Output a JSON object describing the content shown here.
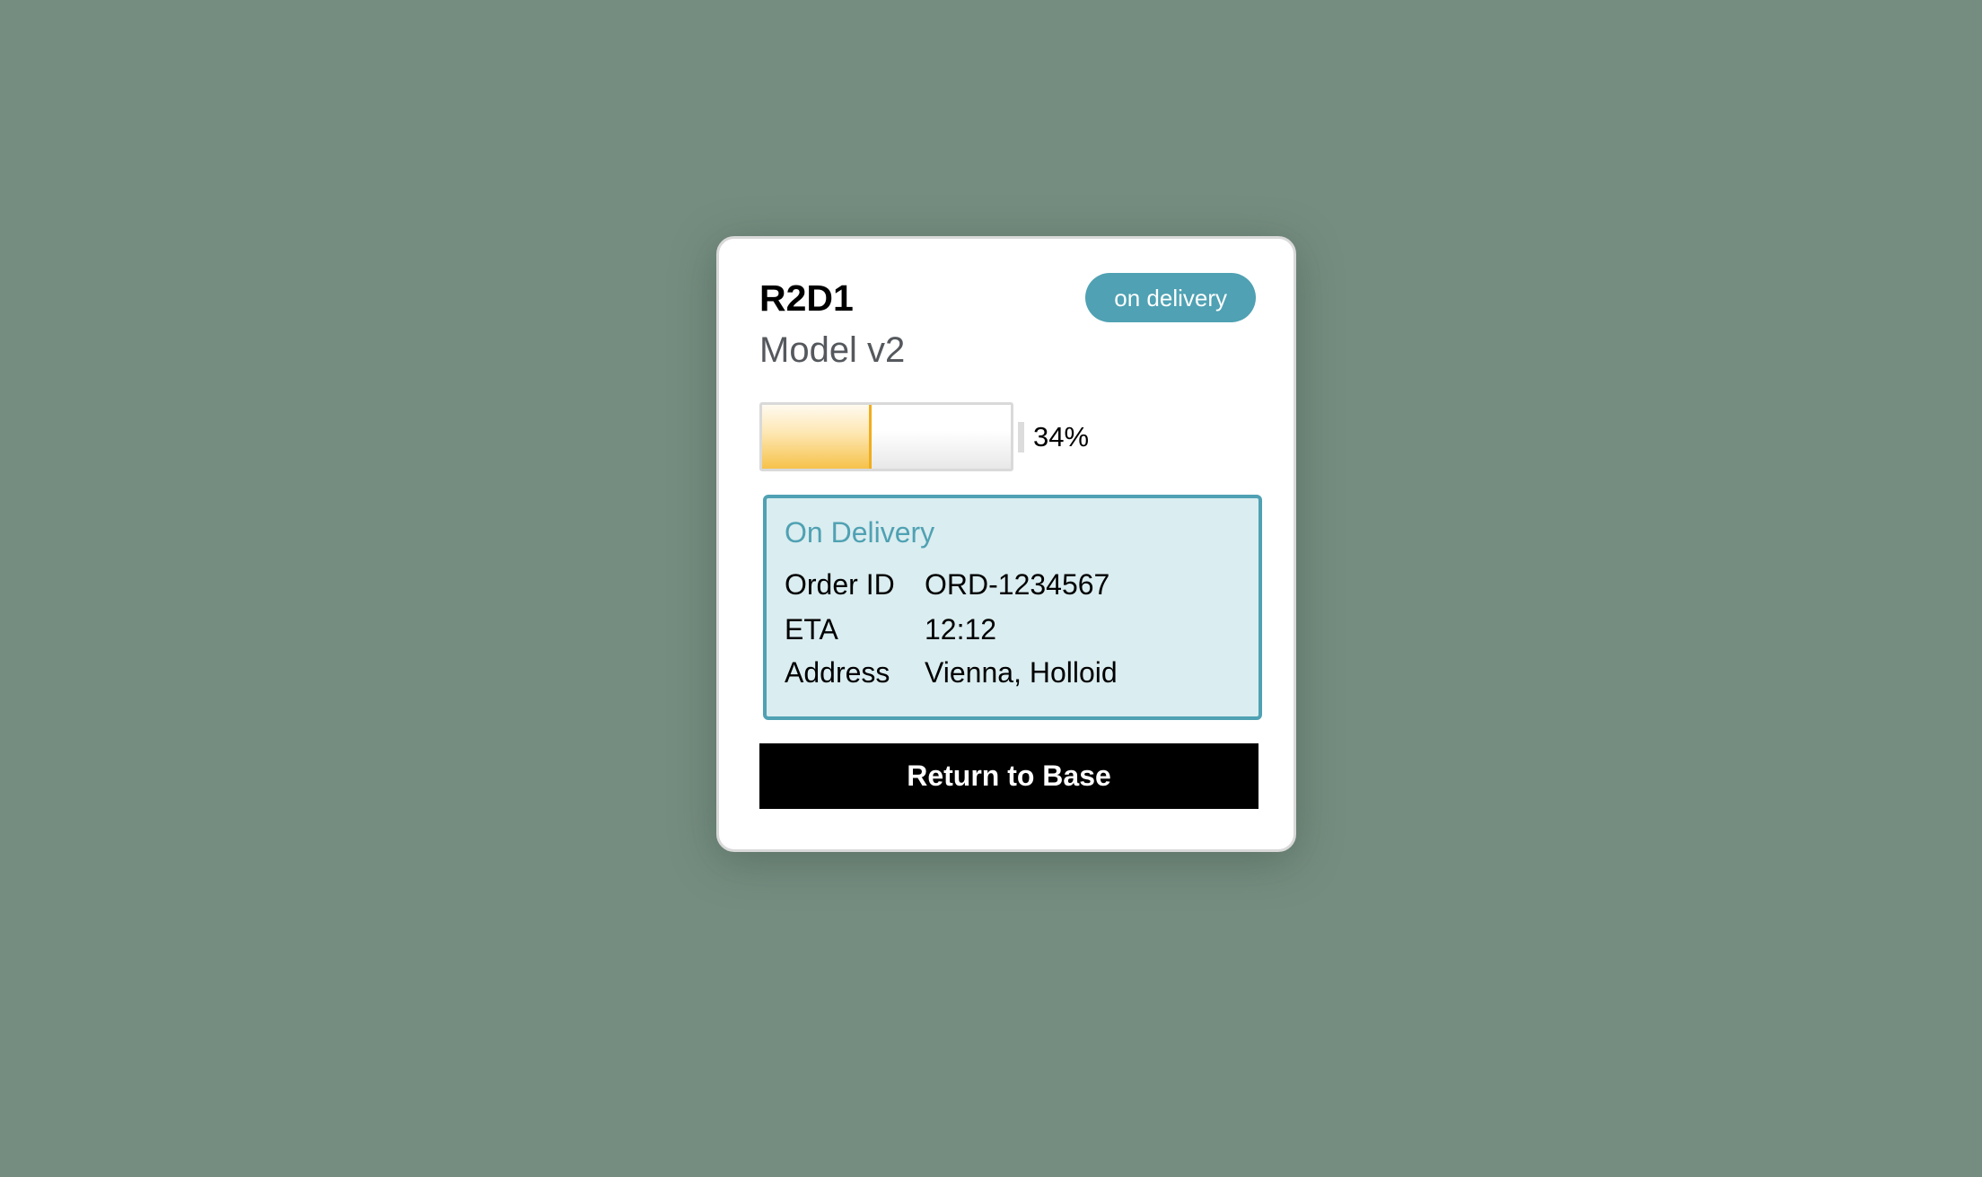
{
  "robot": {
    "name": "R2D1",
    "model": "Model v2",
    "status_badge": "on delivery"
  },
  "battery": {
    "level_percent": 34,
    "label": "34%"
  },
  "delivery": {
    "title": "On Delivery",
    "rows": [
      {
        "label": "Order ID",
        "value": "ORD-1234567"
      },
      {
        "label": "ETA",
        "value": "12:12"
      },
      {
        "label": "Address",
        "value": "Vienna, Holloid"
      }
    ]
  },
  "actions": {
    "return_label": "Return to Base"
  },
  "colors": {
    "accent": "#4fa1b3",
    "battery_fill": "#f0ad1c",
    "background": "#758d80"
  }
}
